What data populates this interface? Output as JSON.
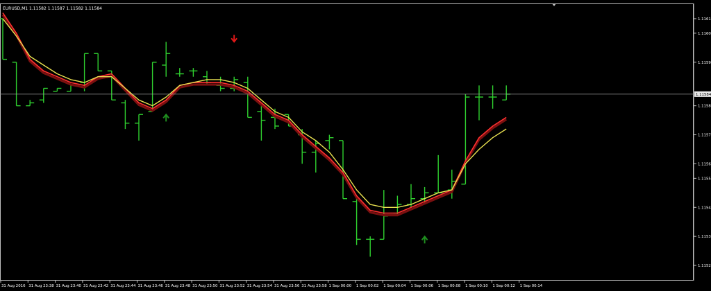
{
  "window": {
    "title": "EURUSD,M1  1.11582 1.11587 1.11582 1.11584"
  },
  "colors": {
    "background": "#000000",
    "frame": "#c0c0c0",
    "bars": "#2fd02f",
    "fast_ma": "#ff3030",
    "slow_ma": "#e8e050",
    "dark_ma": "#7a1010",
    "buy_arrow": "#1f8f1f",
    "sell_arrow": "#e01818",
    "price_line": "#9a9a9a",
    "price_box": "#e8e8e8"
  },
  "chart_data": {
    "type": "ohlc",
    "symbol": "EURUSD",
    "timeframe": "M1",
    "current_price": "1.11584",
    "yrange": [
      1.1152,
      1.11615
    ],
    "y_ticks": [
      "1.11610",
      "1.11605",
      "1.11595",
      "1.11580",
      "1.11570",
      "1.11560",
      "1.11555",
      "1.11545",
      "1.11535",
      "1.11525"
    ],
    "x_ticks": [
      "31 Aug 2016",
      "31 Aug 23:38",
      "31 Aug 23:40",
      "31 Aug 23:42",
      "31 Aug 23:44",
      "31 Aug 23:46",
      "31 Aug 23:48",
      "31 Aug 23:50",
      "31 Aug 23:52",
      "31 Aug 23:54",
      "31 Aug 23:56",
      "31 Aug 23:58",
      "1 Sep 00:00",
      "1 Sep 00:02",
      "1 Sep 00:04",
      "1 Sep 00:06",
      "1 Sep 00:08",
      "1 Sep 00:10",
      "1 Sep 00:12",
      "1 Sep 00:14"
    ],
    "bars": [
      {
        "o": 1.1161,
        "h": 1.1161,
        "l": 1.11596,
        "c": 1.11596
      },
      {
        "o": 1.11595,
        "h": 1.11595,
        "l": 1.1158,
        "c": 1.1158
      },
      {
        "o": 1.1158,
        "h": 1.11582,
        "l": 1.1158,
        "c": 1.11581
      },
      {
        "o": 1.11582,
        "h": 1.11586,
        "l": 1.11581,
        "c": 1.11586
      },
      {
        "o": 1.11585,
        "h": 1.11586,
        "l": 1.11585,
        "c": 1.11586
      },
      {
        "o": 1.11585,
        "h": 1.11587,
        "l": 1.11585,
        "c": 1.11587
      },
      {
        "o": 1.11588,
        "h": 1.11598,
        "l": 1.11585,
        "c": 1.11598
      },
      {
        "o": 1.11598,
        "h": 1.11598,
        "l": 1.11592,
        "c": 1.11592
      },
      {
        "o": 1.11592,
        "h": 1.11592,
        "l": 1.11582,
        "c": 1.11582
      },
      {
        "o": 1.11581,
        "h": 1.11582,
        "l": 1.11572,
        "c": 1.11574
      },
      {
        "o": 1.11574,
        "h": 1.11577,
        "l": 1.11568,
        "c": 1.11577
      },
      {
        "o": 1.11578,
        "h": 1.11595,
        "l": 1.11578,
        "c": 1.11595
      },
      {
        "o": 1.11594,
        "h": 1.11602,
        "l": 1.1159,
        "c": 1.11598
      },
      {
        "o": 1.11591,
        "h": 1.11593,
        "l": 1.1159,
        "c": 1.11591
      },
      {
        "o": 1.11592,
        "h": 1.11593,
        "l": 1.1159,
        "c": 1.11592
      },
      {
        "o": 1.1159,
        "h": 1.11592,
        "l": 1.11587,
        "c": 1.11588
      },
      {
        "o": 1.11587,
        "h": 1.1159,
        "l": 1.11585,
        "c": 1.11586
      },
      {
        "o": 1.11586,
        "h": 1.1159,
        "l": 1.11585,
        "c": 1.11589
      },
      {
        "o": 1.11588,
        "h": 1.1159,
        "l": 1.11576,
        "c": 1.11576
      },
      {
        "o": 1.11578,
        "h": 1.1158,
        "l": 1.11568,
        "c": 1.11575
      },
      {
        "o": 1.11576,
        "h": 1.11579,
        "l": 1.11572,
        "c": 1.11573
      },
      {
        "o": 1.11577,
        "h": 1.11577,
        "l": 1.11573,
        "c": 1.11573
      },
      {
        "o": 1.1157,
        "h": 1.11572,
        "l": 1.1156,
        "c": 1.11564
      },
      {
        "o": 1.11564,
        "h": 1.11568,
        "l": 1.11557,
        "c": 1.11567
      },
      {
        "o": 1.11568,
        "h": 1.1157,
        "l": 1.11565,
        "c": 1.11569
      },
      {
        "o": 1.11568,
        "h": 1.11568,
        "l": 1.11548,
        "c": 1.11548
      },
      {
        "o": 1.11547,
        "h": 1.11548,
        "l": 1.11532,
        "c": 1.11534
      },
      {
        "o": 1.11534,
        "h": 1.11535,
        "l": 1.11528,
        "c": 1.11534
      },
      {
        "o": 1.11534,
        "h": 1.11551,
        "l": 1.11534,
        "c": 1.11542
      },
      {
        "o": 1.11543,
        "h": 1.11549,
        "l": 1.11542,
        "c": 1.11546
      },
      {
        "o": 1.11546,
        "h": 1.11553,
        "l": 1.11545,
        "c": 1.11548
      },
      {
        "o": 1.11548,
        "h": 1.11552,
        "l": 1.11546,
        "c": 1.1155
      },
      {
        "o": 1.1155,
        "h": 1.11563,
        "l": 1.1155,
        "c": 1.1155
      },
      {
        "o": 1.11551,
        "h": 1.11558,
        "l": 1.11548,
        "c": 1.11554
      },
      {
        "o": 1.11553,
        "h": 1.11584,
        "l": 1.11553,
        "c": 1.11583
      },
      {
        "o": 1.11583,
        "h": 1.11587,
        "l": 1.11575,
        "c": 1.11583
      },
      {
        "o": 1.11583,
        "h": 1.11587,
        "l": 1.11579,
        "c": 1.11583
      },
      {
        "o": 1.11582,
        "h": 1.11587,
        "l": 1.11582,
        "c": 1.11584
      }
    ],
    "ma_red": [
      1.11612,
      1.11605,
      1.11596,
      1.11592,
      1.1159,
      1.11588,
      1.11587,
      1.1159,
      1.11591,
      1.11586,
      1.11581,
      1.11579,
      1.11582,
      1.11587,
      1.11588,
      1.11588,
      1.11588,
      1.11587,
      1.11585,
      1.11581,
      1.11577,
      1.11575,
      1.1157,
      1.11566,
      1.11562,
      1.11557,
      1.11549,
      1.11544,
      1.11543,
      1.11543,
      1.11545,
      1.11547,
      1.11549,
      1.11551,
      1.11561,
      1.11569,
      1.11573,
      1.11576
    ],
    "ma_yellow": [
      1.1161,
      1.11604,
      1.11597,
      1.11594,
      1.11591,
      1.11589,
      1.11588,
      1.1159,
      1.1159,
      1.11586,
      1.11582,
      1.1158,
      1.11583,
      1.11587,
      1.11588,
      1.11589,
      1.11589,
      1.11588,
      1.11586,
      1.11582,
      1.11578,
      1.11576,
      1.11571,
      1.11568,
      1.11564,
      1.11558,
      1.11551,
      1.11546,
      1.11545,
      1.11545,
      1.11546,
      1.11548,
      1.1155,
      1.11551,
      1.1156,
      1.11565,
      1.11569,
      1.11572
    ],
    "signals": [
      {
        "type": "buy",
        "bar": 12,
        "price": 1.11576
      },
      {
        "type": "sell",
        "bar": 17,
        "price": 1.11603
      },
      {
        "type": "buy",
        "bar": 31,
        "price": 1.11534
      }
    ]
  }
}
